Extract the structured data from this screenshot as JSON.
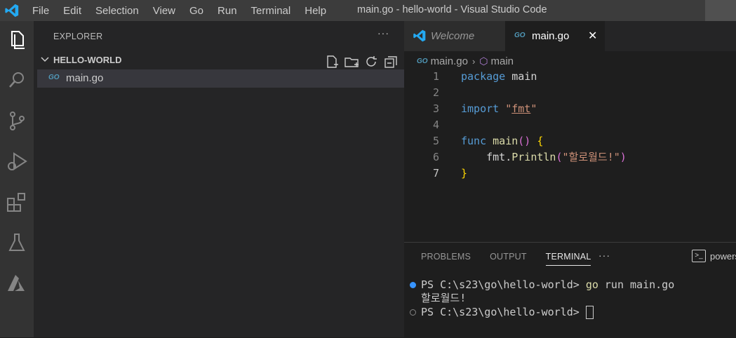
{
  "window": {
    "title": "main.go - hello-world - Visual Studio Code"
  },
  "menu": [
    "File",
    "Edit",
    "Selection",
    "View",
    "Go",
    "Run",
    "Terminal",
    "Help"
  ],
  "activity_bar": [
    "files-icon",
    "search-icon",
    "source-control-icon",
    "run-debug-icon",
    "extensions-icon",
    "testing-icon",
    "azure-icon"
  ],
  "sidebar": {
    "title": "EXPLORER",
    "more": "···",
    "folder": "HELLO-WORLD",
    "folder_actions": [
      "new-file-icon",
      "new-folder-icon",
      "refresh-icon",
      "collapse-all-icon"
    ],
    "files": [
      {
        "icon": "GO",
        "name": "main.go"
      }
    ]
  },
  "tabs": [
    {
      "label": "Welcome",
      "icon": "vscode-icon"
    },
    {
      "label": "main.go",
      "icon": "GO",
      "close": "✕"
    }
  ],
  "breadcrumb": {
    "file": "main.go",
    "symbol": "main",
    "file_icon": "GO"
  },
  "code": {
    "line_numbers": [
      "1",
      "2",
      "3",
      "4",
      "5",
      "6",
      "7"
    ],
    "l1_kw": "package",
    "l1_name": "main",
    "l3_kw": "import",
    "l3_q1": "\"",
    "l3_pkg": "fmt",
    "l3_q2": "\"",
    "l5_kw": "func",
    "l5_fn": "main",
    "l5_paren": "()",
    "l5_brace": "{",
    "l6_obj": "fmt.",
    "l6_fn": "Println",
    "l6_open": "(",
    "l6_str": "\"할로월드!\"",
    "l6_close": ")",
    "l7_brace": "}"
  },
  "panel": {
    "tabs": [
      "PROBLEMS",
      "OUTPUT",
      "TERMINAL"
    ],
    "more": "···",
    "shell": "powers",
    "terminal": {
      "prompt1": "PS C:\\s23\\go\\hello-world> ",
      "cmd": "go",
      "args": " run main.go",
      "output": "할로월드!",
      "prompt2": "PS C:\\s23\\go\\hello-world> "
    }
  },
  "colors": {
    "accent": "#007acc",
    "go": "#519aba",
    "keyword": "#569cd6",
    "string": "#ce9178",
    "function": "#dcdcaa"
  }
}
